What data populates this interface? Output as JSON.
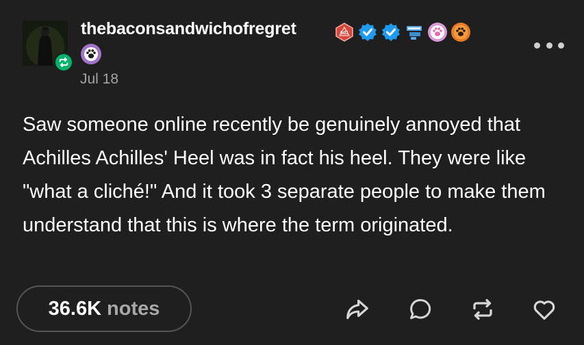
{
  "post": {
    "username": "thebaconsandwichofregret",
    "date": "Jul 18",
    "body": "Saw someone online recently be genuinely annoyed that Achilles Achilles' Heel was in fact his heel. They were like \"what a cliché!\" And it took 3 separate people to make them understand that this is where the term originated.",
    "badges": [
      {
        "icon": "d20-dice-badge-icon",
        "text": "6d1",
        "color": "#d9463b"
      },
      {
        "icon": "verified-check-badge-icon",
        "color": "#1e9bf0"
      },
      {
        "icon": "verified-check-badge-icon",
        "color": "#1e9bf0"
      },
      {
        "icon": "blue-ribbon-badge-icon",
        "color": "#5aa9e6"
      },
      {
        "icon": "pink-paw-badge-icon",
        "color": "#d99bd8"
      },
      {
        "icon": "orange-paw-badge-icon",
        "color": "#e47b24"
      }
    ]
  },
  "footer": {
    "notes_count": "36.6K",
    "notes_label": "notes",
    "actions": [
      {
        "icon": "share-icon"
      },
      {
        "icon": "reply-icon"
      },
      {
        "icon": "reblog-icon"
      },
      {
        "icon": "like-icon"
      }
    ]
  },
  "colors": {
    "background": "#1f1f1f",
    "text": "#ffffff",
    "muted": "#a3a3a3",
    "reblog_green": "#00b36b",
    "verified_blue": "#1e9bf0"
  }
}
